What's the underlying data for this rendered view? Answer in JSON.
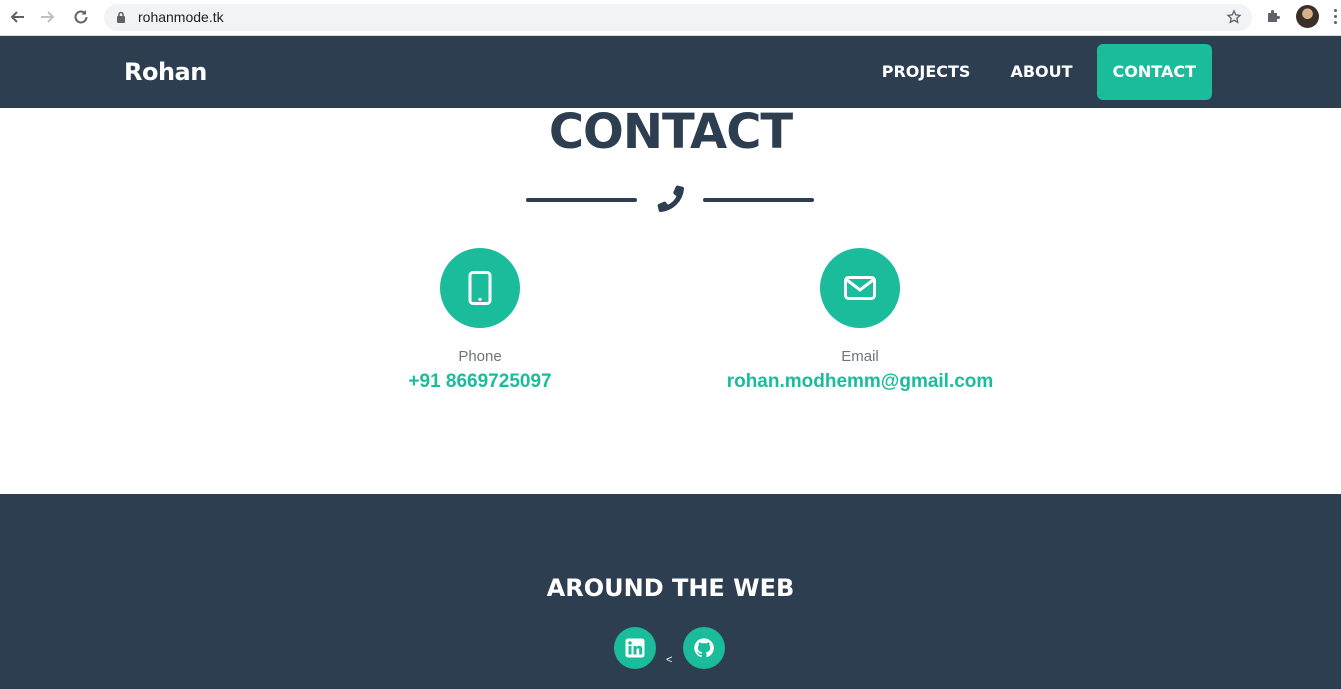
{
  "browser": {
    "url": "rohanmode.tk"
  },
  "navbar": {
    "brand": "Rohan",
    "links": [
      {
        "label": "PROJECTS"
      },
      {
        "label": "ABOUT"
      },
      {
        "label": "CONTACT",
        "active": true
      }
    ]
  },
  "contact": {
    "title": "CONTACT",
    "items": [
      {
        "icon": "mobile-phone-icon",
        "label": "Phone",
        "value": "+91 8669725097"
      },
      {
        "icon": "envelope-icon",
        "label": "Email",
        "value": "rohan.modhemm@gmail.com"
      }
    ]
  },
  "footer": {
    "title": "AROUND THE WEB",
    "separator": "<",
    "social": [
      {
        "icon": "linkedin-icon"
      },
      {
        "icon": "github-icon"
      }
    ]
  },
  "colors": {
    "primary": "#2c3e50",
    "accent": "#1abc9c",
    "muted": "#6c757d"
  }
}
